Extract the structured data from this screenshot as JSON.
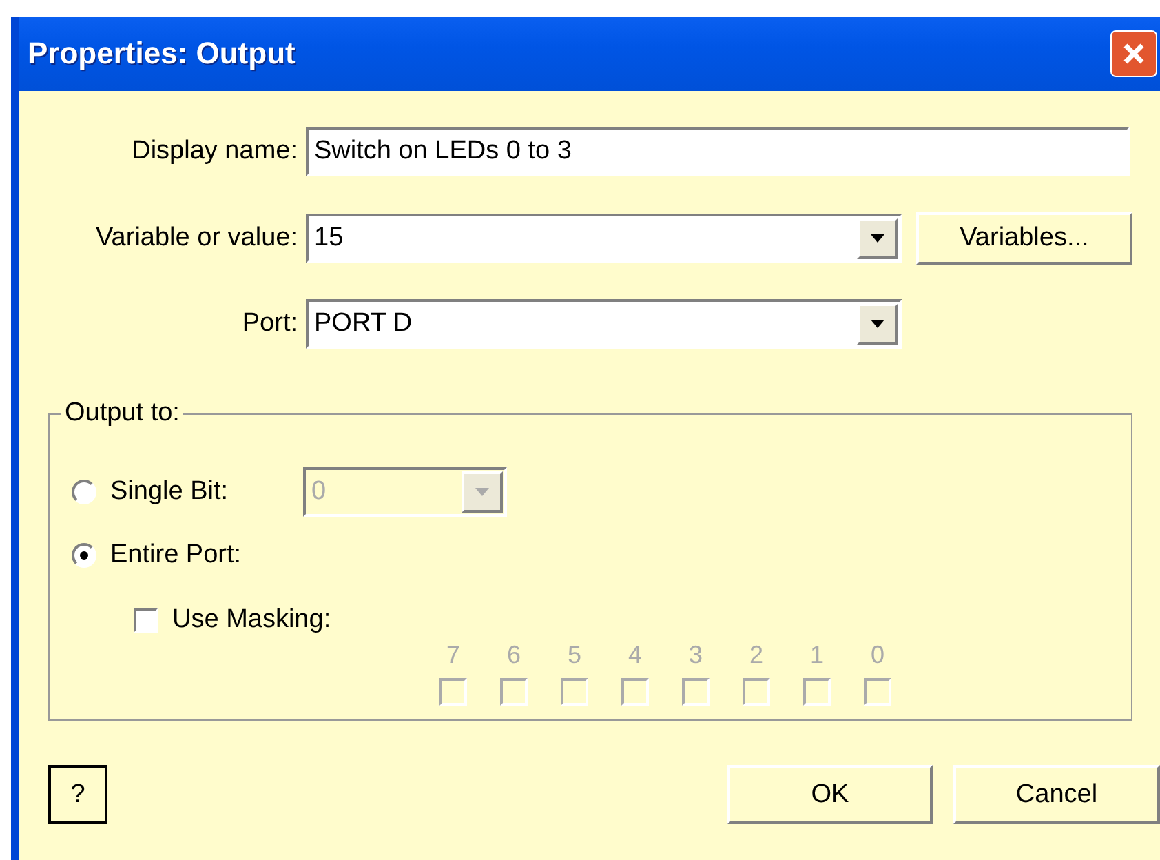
{
  "window": {
    "title": "Properties: Output"
  },
  "fields": [
    {
      "label": "Display name:",
      "value": "Switch on LEDs 0 to 3",
      "kind": "text"
    },
    {
      "label": "Variable or value:",
      "value": "15",
      "kind": "combo"
    },
    {
      "label": "Port:",
      "value": "PORT D",
      "kind": "combo"
    }
  ],
  "variables_button": {
    "label": "Variables..."
  },
  "output_to": {
    "title": "Output to:",
    "options": [
      {
        "label": "Single Bit:",
        "selected": false
      },
      {
        "label": "Entire Port:",
        "selected": true
      }
    ],
    "single_bit": {
      "value": "0",
      "disabled": true
    },
    "use_masking": {
      "label": "Use Masking:",
      "checked": false
    },
    "bits": [
      {
        "label": "7",
        "checked": false,
        "disabled": true
      },
      {
        "label": "6",
        "checked": false,
        "disabled": true
      },
      {
        "label": "5",
        "checked": false,
        "disabled": true
      },
      {
        "label": "4",
        "checked": false,
        "disabled": true
      },
      {
        "label": "3",
        "checked": false,
        "disabled": true
      },
      {
        "label": "2",
        "checked": false,
        "disabled": true
      },
      {
        "label": "1",
        "checked": false,
        "disabled": true
      },
      {
        "label": "0",
        "checked": false,
        "disabled": true
      }
    ]
  },
  "buttons": {
    "help": "?",
    "ok": "OK",
    "cancel": "Cancel"
  }
}
